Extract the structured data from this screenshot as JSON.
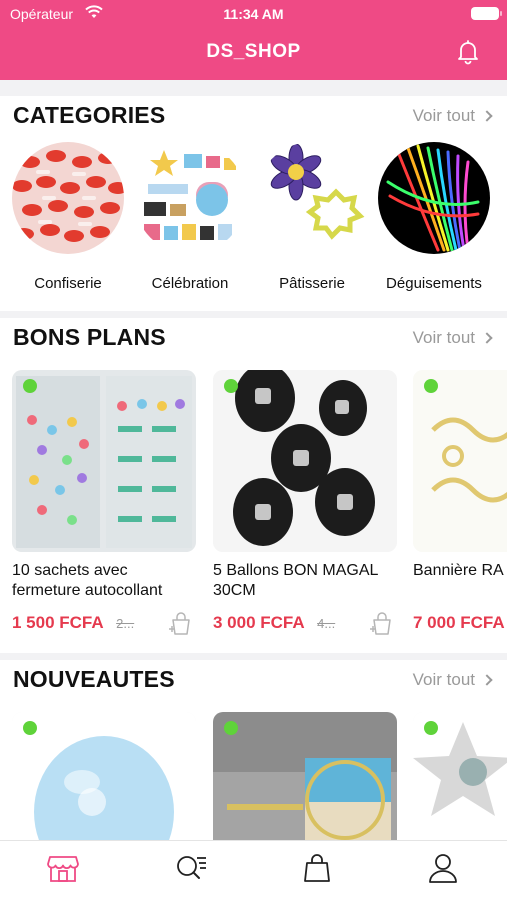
{
  "status_bar": {
    "carrier": "Opérateur",
    "time": "11:34 AM"
  },
  "header": {
    "title": "DS_SHOP"
  },
  "colors": {
    "brand": "#ef4a85",
    "price": "#e53a4e",
    "available": "#5fd33a"
  },
  "categories": {
    "title": "CATEGORIES",
    "see_all": "Voir tout",
    "items": [
      {
        "label": "Confiserie"
      },
      {
        "label": "Célébration"
      },
      {
        "label": "Pâtisserie"
      },
      {
        "label": "Déguisements"
      }
    ]
  },
  "bons_plans": {
    "title": "BONS PLANS",
    "see_all": "Voir tout",
    "items": [
      {
        "name": "10 sachets avec fermeture autocollant",
        "price": "1 500 FCFA",
        "old_price": "2..."
      },
      {
        "name": "5 Ballons  BON MAGAL 30CM",
        "price": "3 000 FCFA",
        "old_price": "4..."
      },
      {
        "name": "Bannière RA KAREEM",
        "price": "7 000 FCFA"
      }
    ]
  },
  "nouveautes": {
    "title": "NOUVEAUTES",
    "see_all": "Voir tout",
    "items": [
      {},
      {},
      {}
    ]
  },
  "tabbar": {
    "items": [
      {
        "icon": "store-icon",
        "active": true
      },
      {
        "icon": "search-list-icon"
      },
      {
        "icon": "shopping-bag-icon"
      },
      {
        "icon": "user-icon"
      }
    ]
  }
}
